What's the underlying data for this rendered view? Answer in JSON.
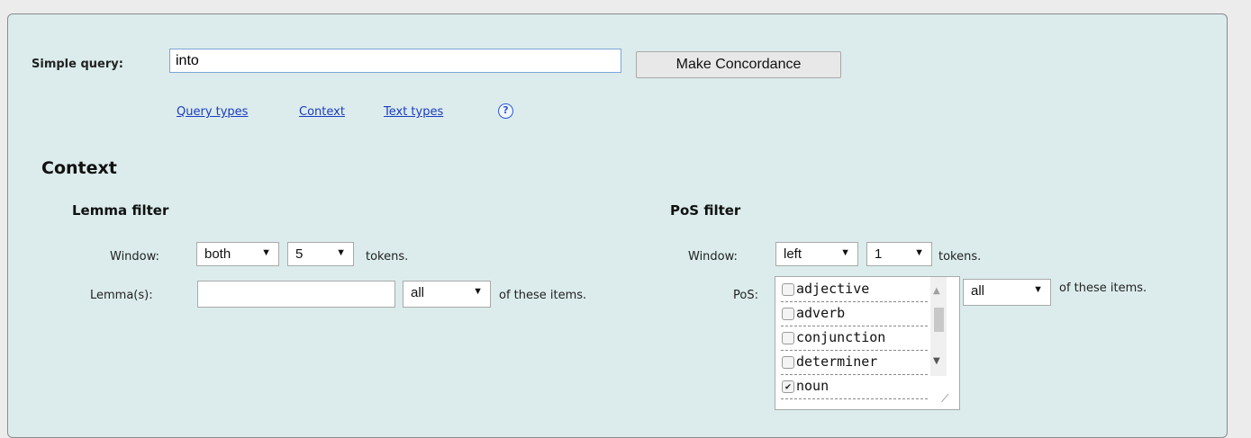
{
  "query": {
    "label": "Simple query:",
    "value": "into",
    "button_label": "Make Concordance"
  },
  "links": {
    "query_types": "Query types",
    "context": "Context",
    "text_types": "Text types",
    "help": "?"
  },
  "context": {
    "heading": "Context",
    "lemma_filter": {
      "heading": "Lemma filter",
      "window_label": "Window:",
      "window_direction": "both",
      "window_size": "5",
      "tokens_label": "tokens.",
      "lemmas_label": "Lemma(s):",
      "lemmas_value": "",
      "match": "all",
      "items_label": "of these items."
    },
    "pos_filter": {
      "heading": "PoS filter",
      "window_label": "Window:",
      "window_direction": "left",
      "window_size": "1",
      "tokens_label": "tokens.",
      "pos_label": "PoS:",
      "match": "all",
      "items_label": "of these items.",
      "options": [
        {
          "label": "adjective",
          "checked": false
        },
        {
          "label": "adverb",
          "checked": false
        },
        {
          "label": "conjunction",
          "checked": false
        },
        {
          "label": "determiner",
          "checked": false
        },
        {
          "label": "noun",
          "checked": true
        }
      ]
    }
  },
  "icons": {
    "dropdown_arrow": "▼",
    "check": "✔",
    "scroll_up": "▲",
    "scroll_down": "▼",
    "resize": "⟋"
  },
  "colors": {
    "panel_bg": "#dcecec",
    "link": "#1a3cc0",
    "input_focus": "#7aa6d6"
  }
}
